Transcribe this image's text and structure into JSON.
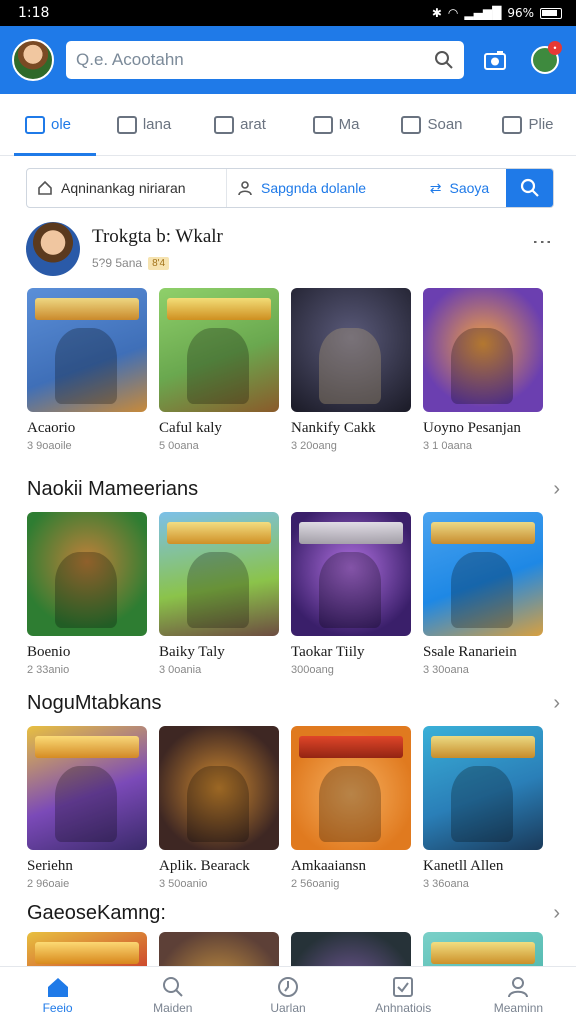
{
  "status": {
    "time": "1:18",
    "battery": "96%"
  },
  "header": {
    "search_placeholder": "Q.e. Acootahn"
  },
  "tabs": [
    {
      "label": "ole",
      "icon": "home-icon",
      "active": true
    },
    {
      "label": "lana",
      "icon": "chart-icon",
      "active": false
    },
    {
      "label": "arat",
      "icon": "edit-icon",
      "active": false
    },
    {
      "label": "Ma",
      "icon": "doc-icon",
      "active": false
    },
    {
      "label": "Soan",
      "icon": "map-icon",
      "active": false
    },
    {
      "label": "Plie",
      "icon": "file-icon",
      "active": false
    }
  ],
  "filter": {
    "first": "Aqninankag niriaran",
    "second": "Sapgnda dolanle",
    "third": "Saoya"
  },
  "profile": {
    "name": "Trokgta b: Wkalr",
    "meta": "5?9 5ana",
    "tag": "8'4"
  },
  "row1": [
    {
      "title": "Acaorio",
      "sub": "3 9oaoile",
      "color": "#3f6fb8"
    },
    {
      "title": "Caful kaly",
      "sub": "5 0oana",
      "color": "#6aa84f"
    },
    {
      "title": "Nankify Cakk",
      "sub": "3 20oang",
      "color": "#2b2b3a"
    },
    {
      "title": "Uoyno Pesanjan",
      "sub": "3 1 0aana",
      "color": "#6b3fb0"
    }
  ],
  "section1": "Naokii Mameerians",
  "row2": [
    {
      "title": "Boenio",
      "sub": "2 33anio",
      "color": "#2e7d32"
    },
    {
      "title": "Baiky Taly",
      "sub": "3 0oania",
      "color": "#8bc34a"
    },
    {
      "title": "Taokar Tiily",
      "sub": "300oang",
      "color": "#5e35b1"
    },
    {
      "title": "Ssale Ranariein",
      "sub": "3 30oana",
      "color": "#1e88e5"
    }
  ],
  "section2": "NoguMtabkans",
  "row3": [
    {
      "title": "Seriehn",
      "sub": "2 96oaie",
      "color": "#7b4ab8"
    },
    {
      "title": "Aplik. Bearack",
      "sub": "3 50oanio",
      "color": "#3e2723"
    },
    {
      "title": "Amkaaiansn",
      "sub": "2 56oanig",
      "color": "#e07a1f"
    },
    {
      "title": "Kanetll Allen",
      "sub": "3 36oana",
      "color": "#2a7fb8"
    }
  ],
  "section3": "GaeoseKamng:",
  "row4": [
    {
      "title": "",
      "sub": "",
      "color": "#c62828"
    },
    {
      "title": "",
      "sub": "",
      "color": "#5d4037"
    },
    {
      "title": "",
      "sub": "",
      "color": "#263238"
    },
    {
      "title": "",
      "sub": "",
      "color": "#4db6ac"
    }
  ],
  "bottom_nav": [
    {
      "label": "Feeio",
      "icon": "home-icon",
      "active": true
    },
    {
      "label": "Maiden",
      "icon": "search-icon",
      "active": false
    },
    {
      "label": "Uarlan",
      "icon": "clock-icon",
      "active": false
    },
    {
      "label": "Anhnatiois",
      "icon": "check-icon",
      "active": false
    },
    {
      "label": "Meaminn",
      "icon": "person-icon",
      "active": false
    }
  ],
  "colors": {
    "accent": "#1f7ae8"
  }
}
